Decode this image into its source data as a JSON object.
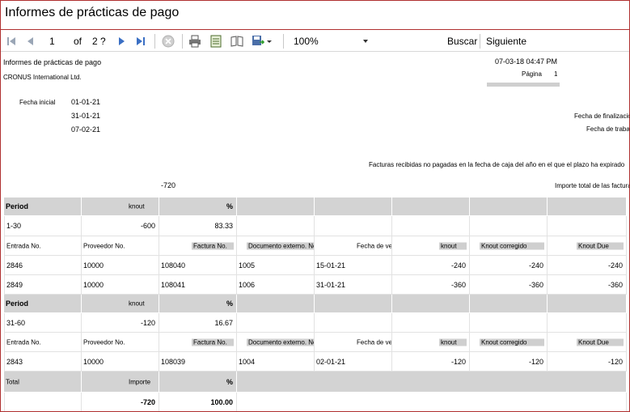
{
  "window": {
    "title": "Informes de prácticas de pago"
  },
  "toolbar": {
    "page_current": "1",
    "page_of": "of",
    "page_total": "2 ?",
    "zoom": "100%",
    "search_label": "Buscar",
    "next_label": "Siguiente"
  },
  "report": {
    "name": "Informes de prácticas de pago",
    "company": "CRONUS International Ltd.",
    "datetime": "07-03-18 04:47 PM",
    "page_label": "Página",
    "page_number": "1",
    "start_date_label": "Fecha inicial",
    "start_date": "01-01-21",
    "end_date": "31-01-21",
    "end_date_label": "Fecha de finalización",
    "work_date": "07-02-21",
    "work_date_label": "Fecha de trabajo",
    "description": "Facturas recibidas no pagadas en la fecha de caja del año en el que el plazo ha expirado",
    "total_value": "-720",
    "total_label": "Importe total de las facturas"
  },
  "table": {
    "period_header": [
      "Period",
      "knout",
      "%"
    ],
    "detail_header": [
      "Entrada No.",
      "Proveedor No.",
      "Factura No.",
      "Documento externo. No.",
      "Fecha de vencimiento",
      "knout",
      "Knout corregido",
      "Knout Due"
    ],
    "groups": [
      {
        "period": "1-30",
        "amount": "-600",
        "percent": "83.33",
        "rows": [
          [
            "2846",
            "10000",
            "108040",
            "1005",
            "15-01-21",
            "-240",
            "-240",
            "-240"
          ],
          [
            "2849",
            "10000",
            "108041",
            "1006",
            "31-01-21",
            "-360",
            "-360",
            "-360"
          ]
        ]
      },
      {
        "period": "31-60",
        "amount": "-120",
        "percent": "16.67",
        "rows": [
          [
            "2843",
            "10000",
            "108039",
            "1004",
            "02-01-21",
            "-120",
            "-120",
            "-120"
          ]
        ]
      }
    ],
    "total_header": [
      "Total",
      "Importe",
      "%"
    ],
    "total_row": [
      "-720",
      "100.00"
    ]
  }
}
